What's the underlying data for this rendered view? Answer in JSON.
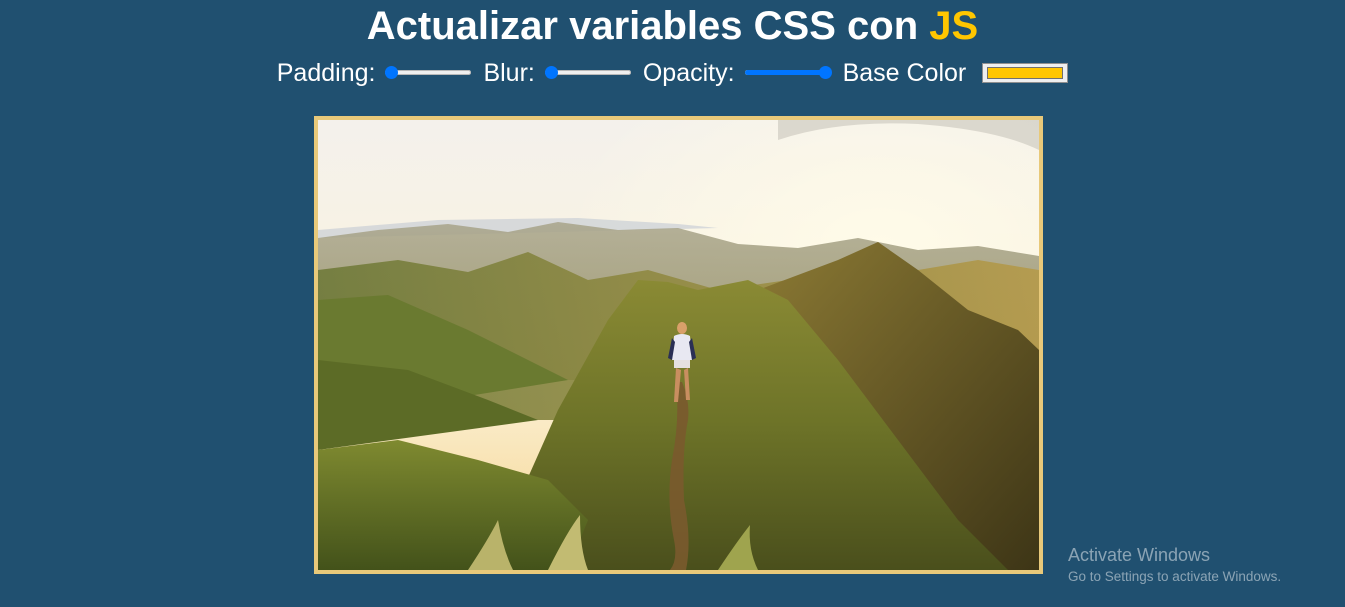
{
  "heading": {
    "text": "Actualizar variables CSS con ",
    "highlight": "JS",
    "highlight_color": "#ffc600"
  },
  "controls": {
    "padding": {
      "label": "Padding:",
      "value": 10,
      "min": 10,
      "max": 200
    },
    "blur": {
      "label": "Blur:",
      "value": 0,
      "min": 0,
      "max": 25
    },
    "opacity": {
      "label": "Opacity:",
      "value": 1,
      "min": 0,
      "max": 1
    },
    "base_color": {
      "label": "Base Color",
      "value": "#ffc600"
    }
  },
  "page_colors": {
    "background": "#205070",
    "accent_slider": "#0075ff",
    "frame": "#e8c97a"
  },
  "image": {
    "subject": "hiker-on-mountain-ridge-at-sunset"
  },
  "watermark": {
    "title": "Activate Windows",
    "subtitle": "Go to Settings to activate Windows."
  }
}
